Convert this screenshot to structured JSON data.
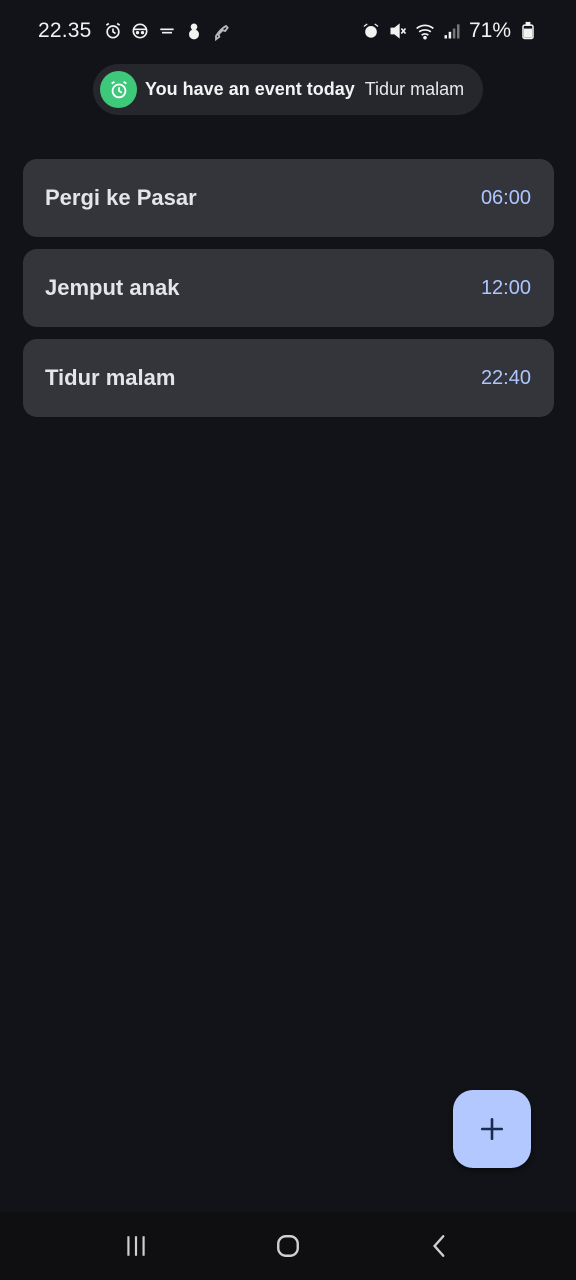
{
  "status_bar": {
    "time": "22.35",
    "battery": "71%",
    "left_icons": [
      "alarm-icon",
      "face-icon",
      "brand-icon",
      "snowman-icon",
      "phone-icon"
    ],
    "right_icons": [
      "alarm-icon",
      "mute-icon",
      "wifi-icon",
      "signal-icon",
      "battery-icon"
    ]
  },
  "notification": {
    "title": "You have an event today",
    "subtitle": "Tidur malam",
    "icon": "alarm-icon",
    "icon_bg": "#3ec87a"
  },
  "events": [
    {
      "title": "Pergi ke Pasar",
      "time": "06:00"
    },
    {
      "title": "Jemput anak",
      "time": "12:00"
    },
    {
      "title": "Tidur malam",
      "time": "22:40"
    }
  ],
  "fab": {
    "icon": "plus-icon",
    "color": "#b3c8ff"
  },
  "nav_bar": {
    "buttons": [
      "recents-icon",
      "home-icon",
      "back-icon"
    ]
  },
  "colors": {
    "background": "#121318",
    "card": "#34353b",
    "time_accent": "#aec6ff"
  }
}
